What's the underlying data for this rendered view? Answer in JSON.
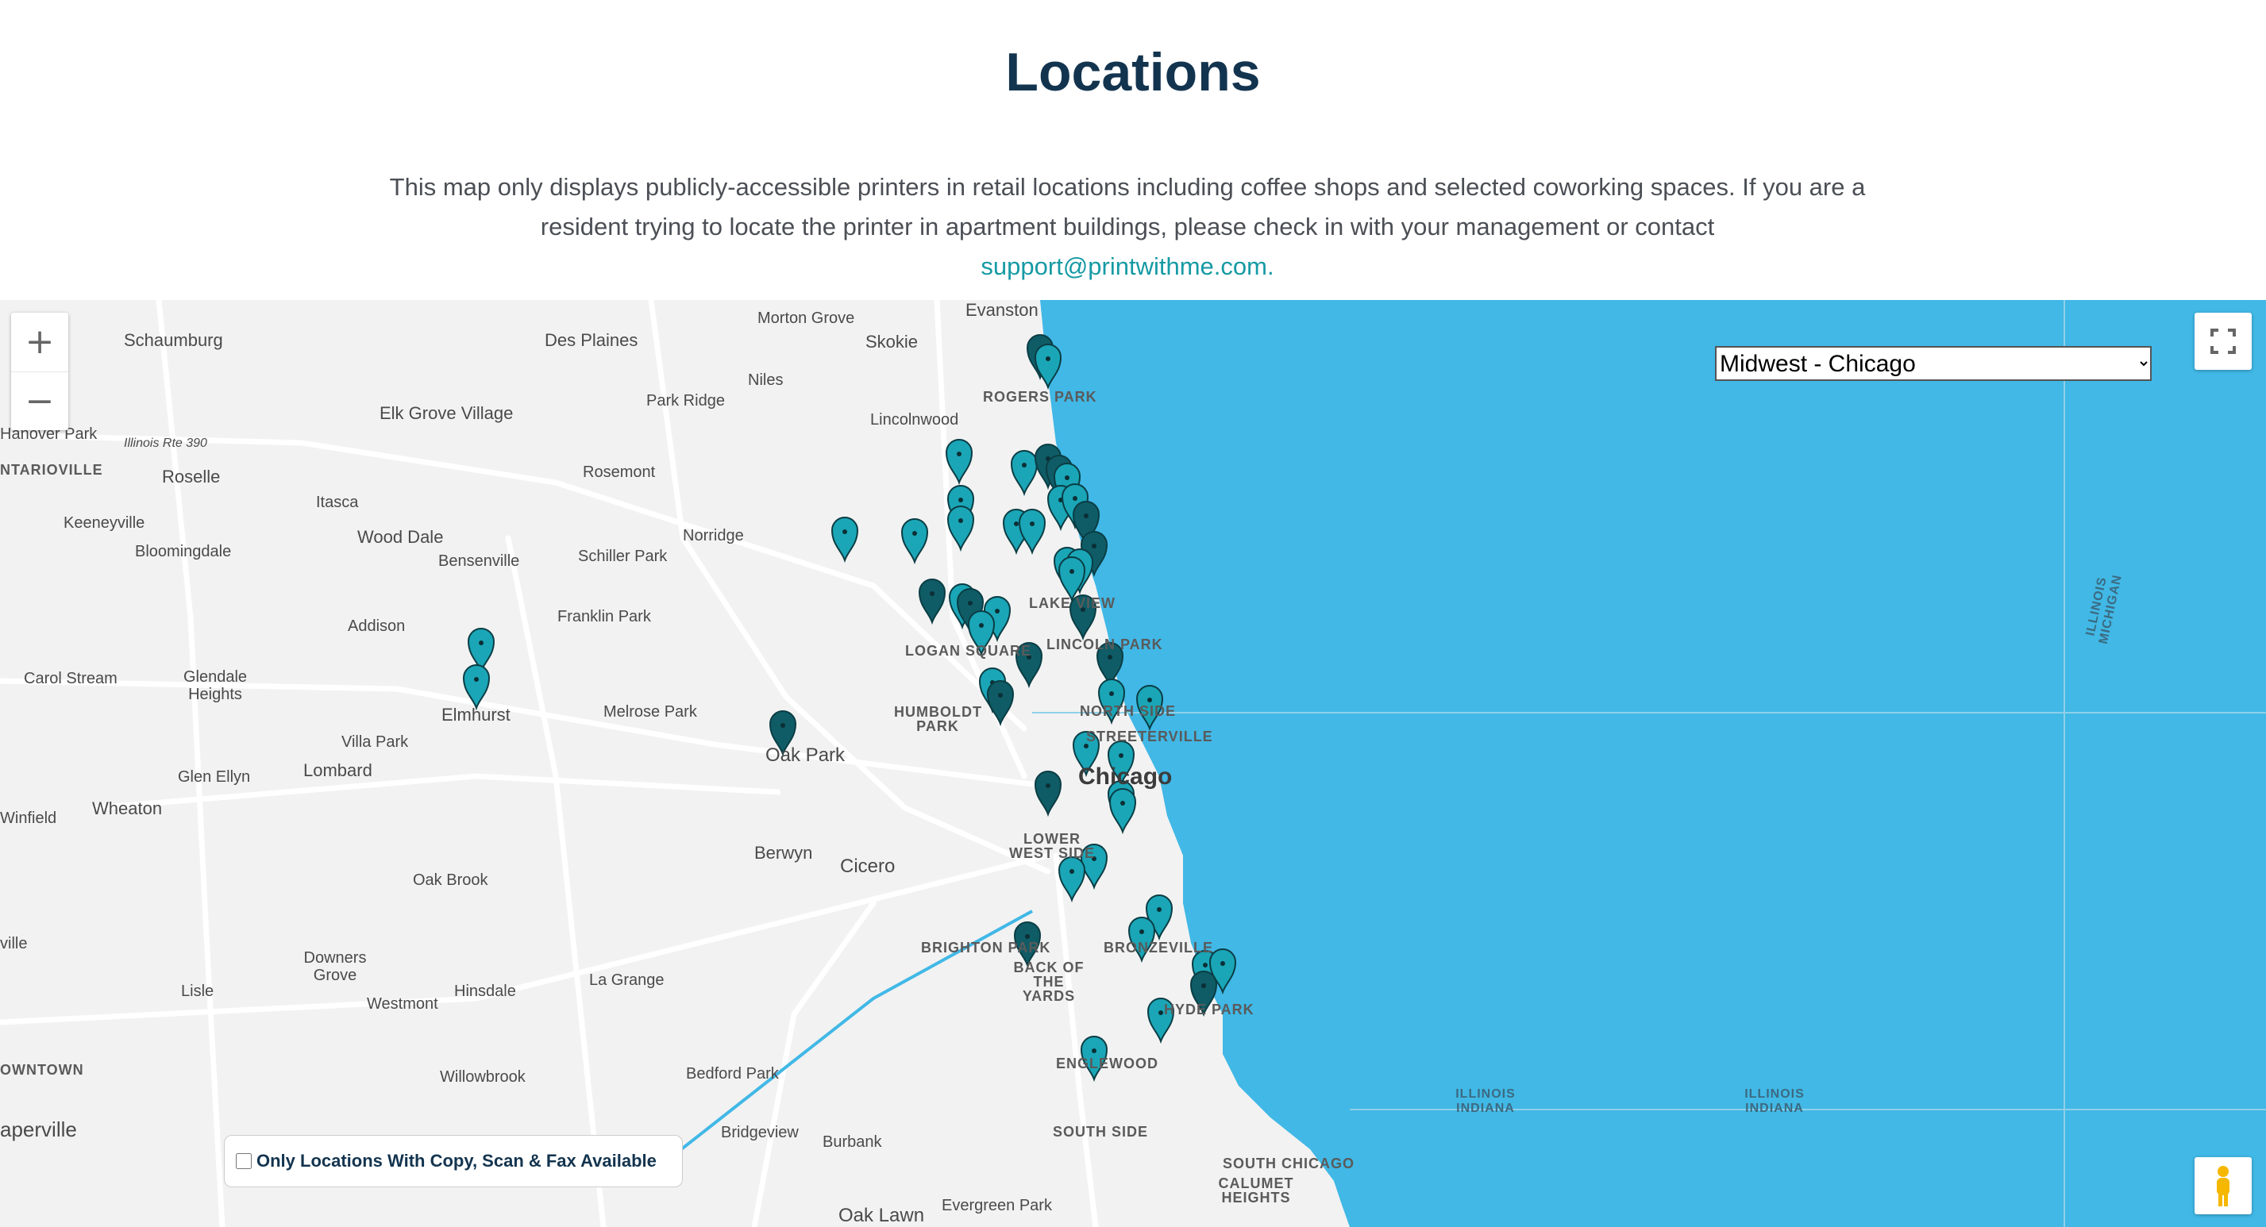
{
  "title": "Locations",
  "intro": {
    "text": "This map only displays publicly-accessible printers in retail locations including coffee shops and selected coworking spaces. If you are a resident trying to locate the printer in apartment buildings, please check in with your management or contact",
    "link": "support@printwithme.com."
  },
  "map": {
    "region_options": [
      "Midwest - Chicago"
    ],
    "region_selected": "Midwest - Chicago",
    "filter_label": "Only Locations With Copy, Scan & Fax Available",
    "zoom_in": "+",
    "zoom_out": "−",
    "colors": {
      "water": "#41b8e6",
      "land": "#f2f2f2",
      "pin_light": "#1aa6b7",
      "pin_dark": "#0f5c66",
      "highway": "#ffffff"
    },
    "icons": [
      "zoom-in-icon",
      "zoom-out-icon",
      "fullscreen-icon",
      "pegman-icon",
      "map-pin-icon"
    ],
    "place_labels": [
      "Schaumburg",
      "Des Plaines",
      "Morton Grove",
      "Evanston",
      "Skokie",
      "Niles",
      "ROGERS PARK",
      "Park Ridge",
      "Lincolnwood",
      "Elk Grove Village",
      "Hanover Park",
      "Illinois Rte 390",
      "NTARIOVILLE",
      "Roselle",
      "Rosemont",
      "Itasca",
      "Keeneyville",
      "Wood Dale",
      "Bensenville",
      "Schiller Park",
      "Norridge",
      "Bloomingdale",
      "Addison",
      "Franklin Park",
      "LAKE VIEW",
      "LINCOLN PARK",
      "LOGAN SQUARE",
      "Carol Stream",
      "Glendale Heights",
      "Elmhurst",
      "Melrose Park",
      "HUMBOLDT PARK",
      "NORTH SIDE",
      "Oak Park",
      "Villa Park",
      "STREETERVILLE",
      "Lombard",
      "Glen Ellyn",
      "Chicago",
      "Wheaton",
      "Winfield",
      "LOWER WEST SIDE",
      "Berwyn",
      "Cicero",
      "Oak Brook",
      "ville",
      "Downers Grove",
      "Lisle",
      "Westmont",
      "Hinsdale",
      "La Grange",
      "BRIGHTON PARK",
      "BACK OF THE YARDS",
      "BRONZEVILLE",
      "HYDE PARK",
      "ENGLEWOOD",
      "OWNTOWN",
      "Willowbrook",
      "Bedford Park",
      "aperville",
      "Bridgeview",
      "Burbank",
      "SOUTH SIDE",
      "SOUTH CHICAGO",
      "CALUMET HEIGHTS",
      "Oak Lawn",
      "Evergreen Park",
      "ILLINOIS INDIANA",
      "ILLINOIS MICHIGAN"
    ]
  }
}
